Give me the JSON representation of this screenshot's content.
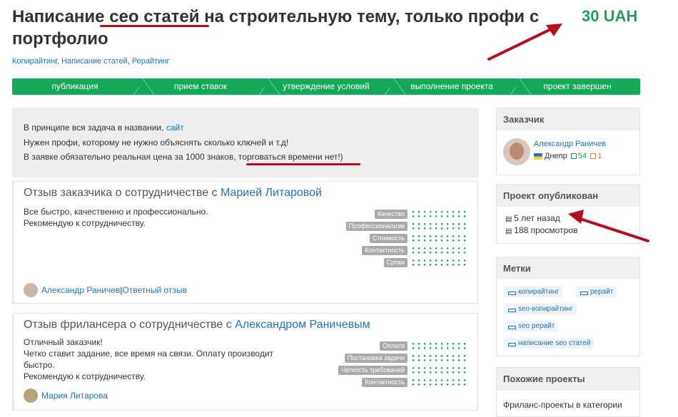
{
  "project": {
    "title_pre": "Написание ",
    "title_highlight": "сео статей",
    "title_post": " на строительную тему, только профи с портфолио",
    "price": "30 UAH",
    "categories": [
      "Копирайтинг",
      "Написание статей",
      "Рерайтинг"
    ],
    "category_sep": ", "
  },
  "progress": {
    "steps": [
      "публикация",
      "прием ставок",
      "утверждение условий",
      "выполнение проекта",
      "проект завершен"
    ]
  },
  "description": {
    "line1_text": "В принципе вся задача в названии, ",
    "line1_link": "сайт",
    "line2": "Нужен профи, которому не нужно объяснять сколько ключей и т.д!",
    "line3_pre": "В заявке обязательно реальная цена за 1000 знаков, ",
    "line3_highlight": "торговаться времени нет!)"
  },
  "review1": {
    "heading": "Отзыв заказчика о сотрудничестве с ",
    "heading_link": "Марией Литаровой",
    "text_line1": "Все быстро, качественно и профессионально.",
    "text_line2": "Рекомендую к сотрудничеству.",
    "rating_labels": [
      "Качество",
      "Профессионализм",
      "Стоимость",
      "Контактность",
      "Сроки"
    ],
    "author": "Александр Раничев",
    "separator": " | ",
    "reply_link": "Ответный отзыв"
  },
  "review2": {
    "heading": "Отзыв фрилансера о сотрудничестве с ",
    "heading_link": "Александром Раничевым",
    "text_line1": "Отличный заказчик!",
    "text_line2": "Четко ставит задание, все время на связи. Оплату производит",
    "text_line3": "быстро.",
    "text_line4": "Рекомендую к сотрудничеству.",
    "rating_labels": [
      "Оплата",
      "Постановка задачи",
      "Четкость требований",
      "Контактность"
    ],
    "author": "Мария Литарова"
  },
  "sidebar": {
    "client_heading": "Заказчик",
    "client_name": "Александр Раничев",
    "client_city": "Днепр",
    "client_positive": "54",
    "client_negative": "1",
    "published_heading": "Проект опубликован",
    "published_ago": "5 лет назад",
    "views": "188 просмотров",
    "tags_heading": "Метки",
    "tags": [
      "копирайтинг",
      "рерайт",
      "seo-копирайтинг",
      "seo рерайт",
      "написание seo статей"
    ],
    "similar_heading": "Похожие проекты",
    "similar_text": "Фриланс-проекты в категории"
  },
  "colors": {
    "accent_green": "#14a957",
    "price_green": "#1ea05a",
    "link_blue": "#1e73be",
    "annotation_red": "#b50c1e"
  }
}
